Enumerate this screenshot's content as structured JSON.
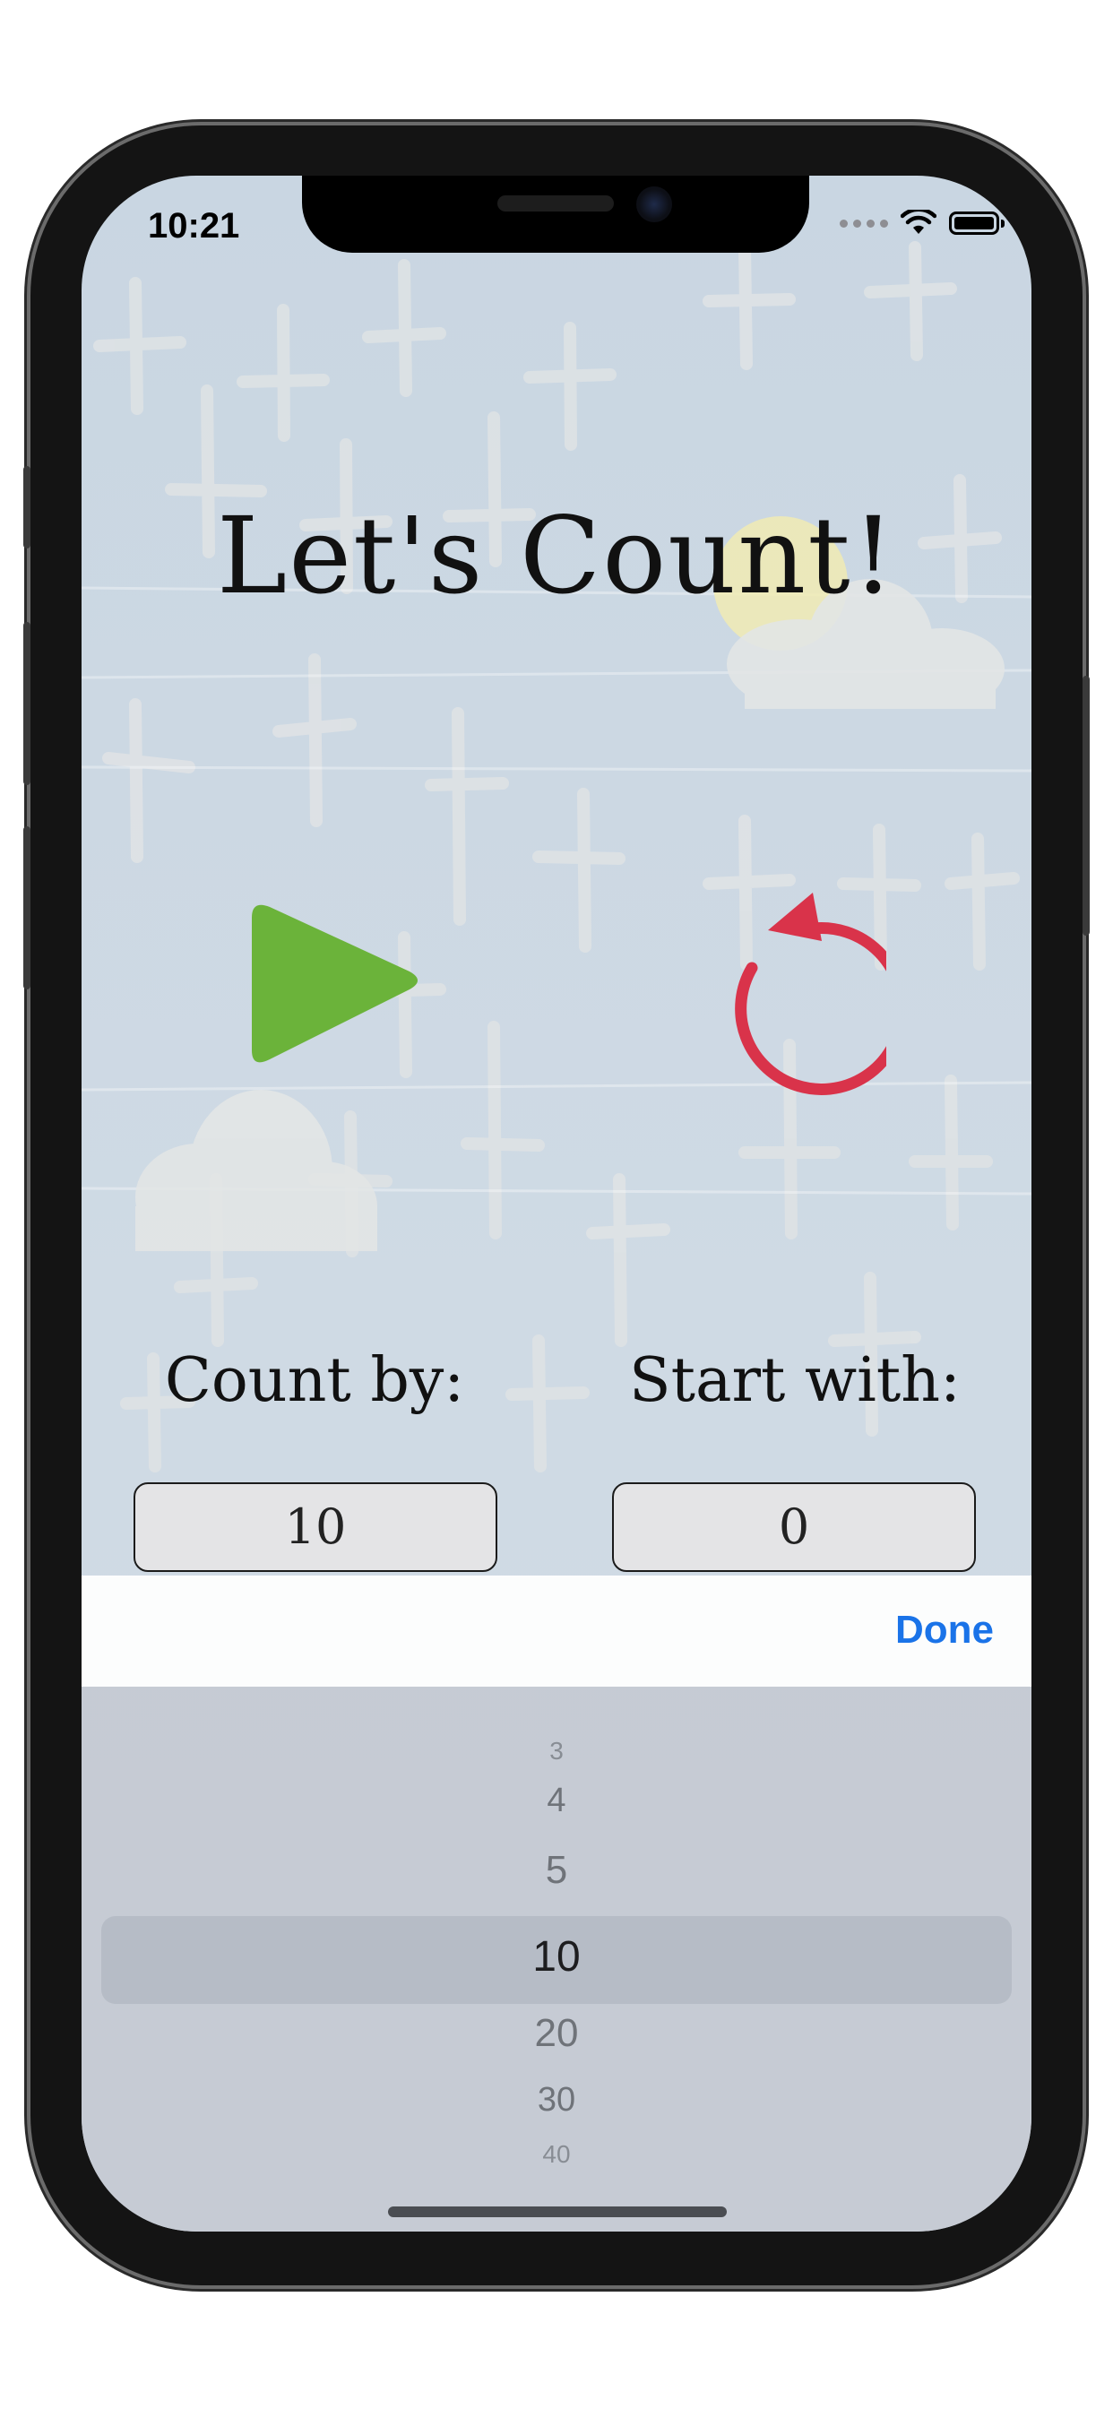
{
  "status_bar": {
    "time": "10:21"
  },
  "app": {
    "title": "Let's Count!",
    "count_by_label": "Count by:",
    "start_with_label": "Start with:",
    "count_by_value": "10",
    "start_with_value": "0"
  },
  "toolbar": {
    "done_label": "Done"
  },
  "picker": {
    "items": [
      "3",
      "4",
      "5",
      "10",
      "20",
      "30",
      "40"
    ],
    "selected": "10"
  },
  "colors": {
    "play": "#6bb33a",
    "reset": "#d9334a",
    "done": "#1a73e8"
  }
}
